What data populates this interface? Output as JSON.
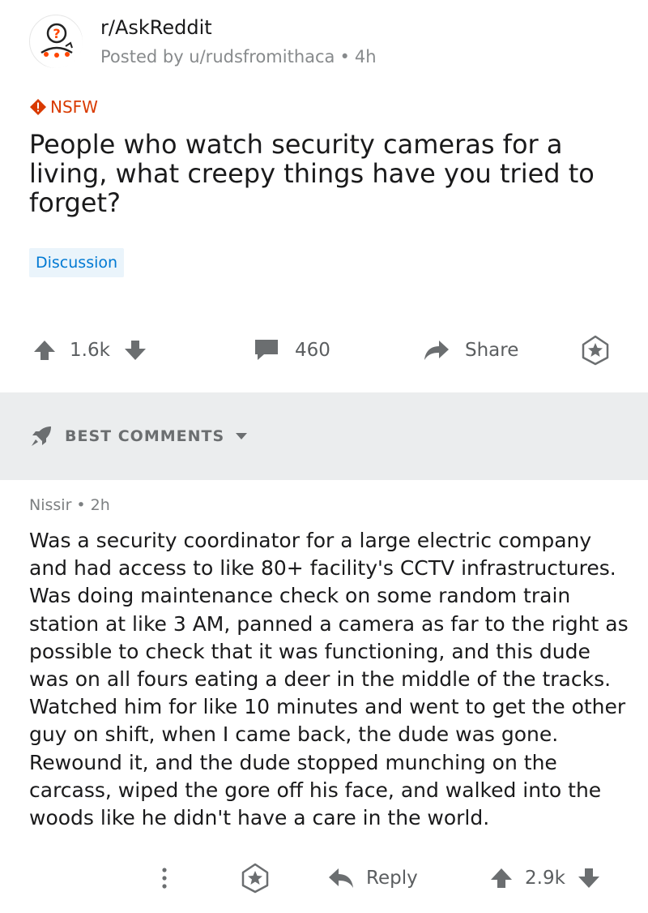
{
  "post": {
    "subreddit": "r/AskReddit",
    "posted_by_label": "Posted by u/rudsfromithaca",
    "meta_separator": "•",
    "age": "4h",
    "nsfw_label": "NSFW",
    "title": "People who watch security cameras for a living, what creepy things have you tried to forget?",
    "flair": "Discussion",
    "votes": "1.6k",
    "comments": "460",
    "share_label": "Share"
  },
  "sort": {
    "label": "BEST COMMENTS"
  },
  "comment": {
    "author": "Nissir",
    "separator": "•",
    "age": "2h",
    "body": "Was a security coordinator for a large electric company and had access to like 80+ facility's CCTV infrastructures. Was doing maintenance check on some random train station at like 3 AM, panned a camera as far to the right as possible to check that it was functioning, and this dude was on all fours eating a deer in the middle of the tracks.  Watched him for like 10 minutes and went to get the other guy on shift, when I came back, the dude was gone.  Rewound it, and the dude stopped munching on the carcass, wiped the gore off his face, and walked into the woods like he didn't have a care in the world.",
    "reply_label": "Reply",
    "votes": "2.9k"
  },
  "icons": {
    "avatar": "askreddit-avatar-icon",
    "nsfw": "nsfw-warning-icon",
    "upvote": "upvote-arrow-icon",
    "downvote": "downvote-arrow-icon",
    "comment": "comment-bubble-icon",
    "share": "share-arrow-icon",
    "award": "award-icon",
    "sort": "rocket-icon",
    "caret": "caret-down-icon",
    "more": "more-dots-icon",
    "reply": "reply-arrow-icon"
  },
  "colors": {
    "nsfw": "#d93a00",
    "flair_bg": "#eaf4fb",
    "flair_text": "#0079d3",
    "sort_bar_bg": "#ebedee",
    "icon_gray": "#6b6e70"
  }
}
